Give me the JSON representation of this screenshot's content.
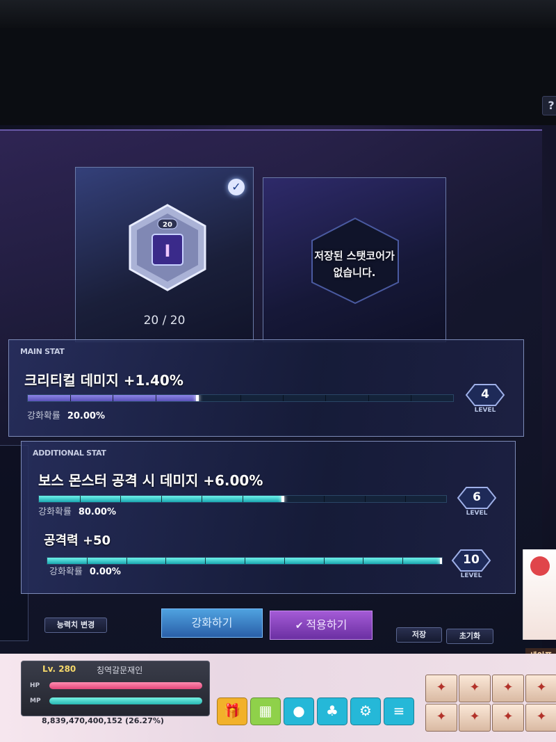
{
  "help": {
    "label": "?"
  },
  "core": {
    "level_badge": "20",
    "count": "20 / 20",
    "empty_message_line1": "저장된 스탯코어가",
    "empty_message_line2": "없습니다."
  },
  "main_stat": {
    "section_label": "MAIN STAT",
    "name": "크리티컬 데미지 +1.40%",
    "rate_label": "강화확률",
    "rate_value": "20.00%",
    "level": "4",
    "level_word": "LEVEL",
    "progress_fraction": 0.4
  },
  "additional_stats": {
    "section_label": "ADDITIONAL STAT",
    "items": [
      {
        "name": "보스 몬스터 공격 시 데미지 +6.00%",
        "rate_label": "강화확률",
        "rate_value": "80.00%",
        "level": "6",
        "level_word": "LEVEL",
        "progress_fraction": 0.6
      },
      {
        "name": "공격력 +50",
        "rate_label": "강화확률",
        "rate_value": "0.00%",
        "level": "10",
        "level_word": "LEVEL",
        "progress_fraction": 1.0
      }
    ]
  },
  "buttons": {
    "change_stat": "능력치 변경",
    "enhance": "강화하기",
    "apply": "적용하기",
    "save": "저장",
    "reset": "초기화"
  },
  "hud": {
    "level": "Lv. 280",
    "character_name": "칭역갈문재인",
    "hp_tag": "HP",
    "mp_tag": "MP",
    "exp": "8,839,470,400,152 (26.27%)",
    "event_tag": "세이프"
  },
  "colors": {
    "accent_cyan": "#1aa7b0",
    "accent_purple": "#6b2fa2",
    "accent_blue": "#2a5fa8"
  },
  "icons": {
    "check": "check-icon",
    "help": "help-icon",
    "menu": [
      "gift-icon",
      "calendar-icon",
      "chat-icon",
      "guild-icon",
      "settings-icon",
      "menu-icon"
    ]
  }
}
